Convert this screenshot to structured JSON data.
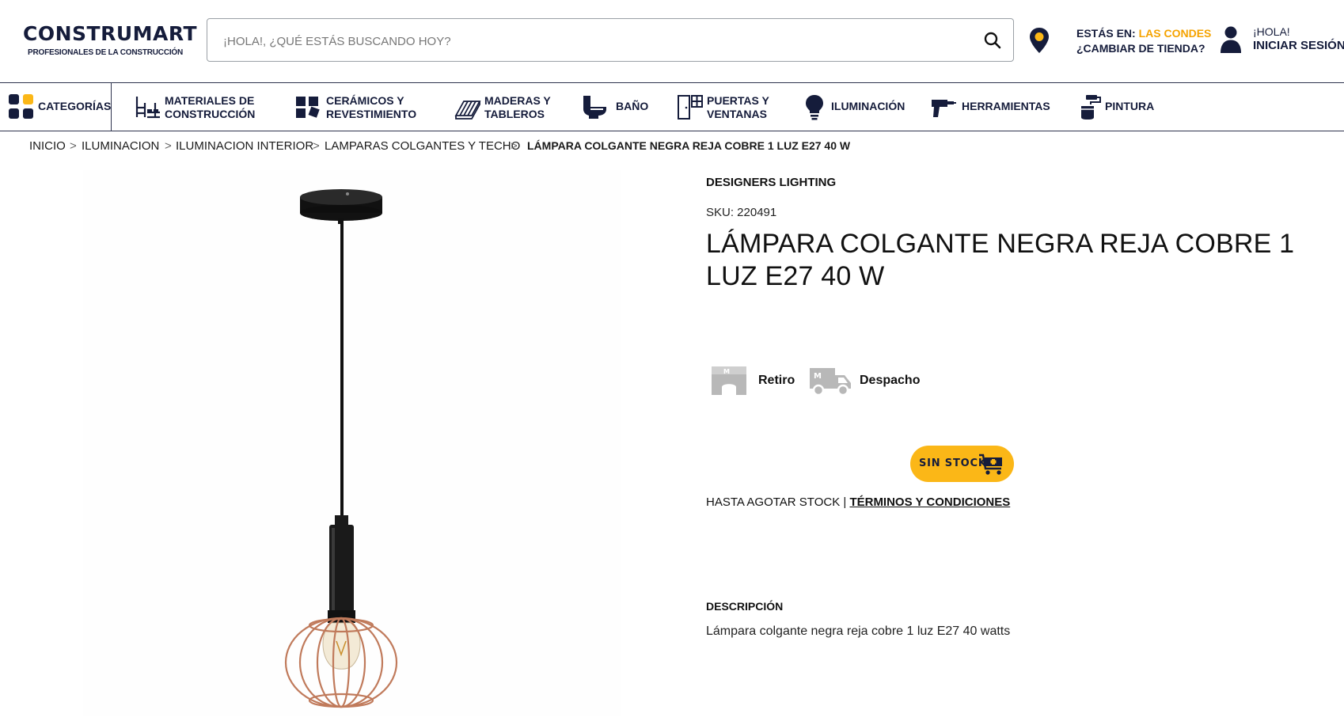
{
  "header": {
    "logo_text": "CONSTRUMART",
    "logo_tagline": "PROFESIONALES DE LA CONSTRUCCIÓN",
    "search_placeholder": "¡HOLA!, ¿QUÉ ESTÁS BUSCANDO HOY?",
    "store_prefix": "ESTÁS EN: ",
    "store_name": "LAS CONDES",
    "change_store": "¿CAMBIAR DE TIENDA?",
    "greeting": "¡HOLA!",
    "login": "INICIAR SESIÓN",
    "colors": {
      "brand_navy": "#151c3b",
      "accent": "#f5a300",
      "button_yellow": "#fbb717"
    }
  },
  "nav": {
    "items": [
      {
        "label": "CATEGORÍAS",
        "icon": "grid-icon"
      },
      {
        "label": "MATERIALES DE\nCONSTRUCCIÓN",
        "icon": "scaffold-icon"
      },
      {
        "label": "CERÁMICOS Y\nREVESTIMIENTO",
        "icon": "tiles-icon"
      },
      {
        "label": "MADERAS Y\nTABLEROS",
        "icon": "wood-planks-icon"
      },
      {
        "label": "BAÑO",
        "icon": "toilet-icon"
      },
      {
        "label": "PUERTAS Y\nVENTANAS",
        "icon": "door-window-icon"
      },
      {
        "label": "ILUMINACIÓN",
        "icon": "lightbulb-icon"
      },
      {
        "label": "HERRAMIENTAS",
        "icon": "drill-icon"
      },
      {
        "label": "PINTURA",
        "icon": "paint-roller-icon"
      }
    ]
  },
  "breadcrumb": {
    "items": [
      "INICIO",
      "ILUMINACION",
      "ILUMINACION INTERIOR",
      "LAMPARAS COLGANTES Y TECHO"
    ],
    "current": "LÁMPARA COLGANTE NEGRA REJA COBRE 1 LUZ E27 40 W",
    "separator": ">"
  },
  "product": {
    "brand": "DESIGNERS LIGHTING",
    "sku": "SKU: 220491",
    "title": "LÁMPARA COLGANTE NEGRA REJA COBRE 1 LUZ E27 40 W",
    "delivery": {
      "pickup_label": "Retiro",
      "shipping_label": "Despacho"
    },
    "stock_button": "SIN STOCK",
    "stock_note": "HASTA AGOTAR STOCK | ",
    "terms_link": "TÉRMINOS Y CONDICIONES",
    "description_heading": "DESCRIPCIÓN",
    "description": "Lámpara colgante negra reja cobre 1 luz E27 40 watts",
    "image_subject": "pendant-lamp-image"
  }
}
